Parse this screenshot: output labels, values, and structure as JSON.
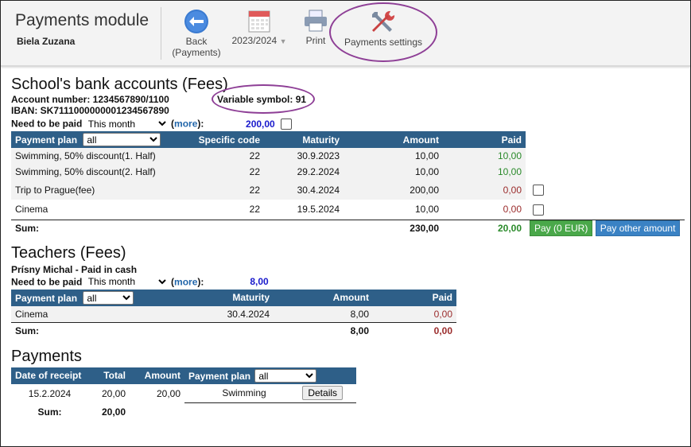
{
  "header": {
    "title": "Payments module",
    "user": "Biela Zuzana",
    "back_label_1": "Back",
    "back_label_2": "(Payments)",
    "year_label": "2023/2024",
    "print_label": "Print",
    "settings_label": "Payments settings"
  },
  "bank": {
    "title": "School's bank accounts (Fees)",
    "account": "Account number: 1234567890/1100",
    "iban": "IBAN: SK7111000000001234567890",
    "variable_symbol": "Variable symbol: 91",
    "need_label": "Need to be paid",
    "need_period": "This month",
    "more_open": "(",
    "more_link": "more",
    "more_close": "):",
    "need_amount": "200,00",
    "columns": [
      "Payment plan",
      "Specific code",
      "Maturity",
      "Amount",
      "Paid"
    ],
    "plan_filter": "all",
    "rows": [
      {
        "plan": "Swimming, 50% discount(1. Half)",
        "code": "22",
        "maturity": "30.9.2023",
        "amount": "10,00",
        "paid": "10,00"
      },
      {
        "plan": "Swimming, 50% discount(2. Half)",
        "code": "22",
        "maturity": "29.2.2024",
        "amount": "10,00",
        "paid": "10,00"
      },
      {
        "plan": "Trip to Prague(fee)",
        "code": "22",
        "maturity": "30.4.2024",
        "amount": "200,00",
        "paid": "0,00"
      },
      {
        "plan": "Cinema",
        "code": "22",
        "maturity": "19.5.2024",
        "amount": "10,00",
        "paid": "0,00"
      }
    ],
    "sum_label": "Sum:",
    "sum_amount": "230,00",
    "sum_paid": "20,00",
    "pay_button": "Pay (0 EUR)",
    "pay_other_button": "Pay other amount"
  },
  "teachers": {
    "title": "Teachers (Fees)",
    "subtitle": "Prísny Michal - Paid in cash",
    "need_label": "Need to be paid",
    "need_period": "This month",
    "more_open": "(",
    "more_link": "more",
    "more_close": "):",
    "need_amount": "8,00",
    "columns": [
      "Payment plan",
      "Maturity",
      "Amount",
      "Paid"
    ],
    "plan_filter": "all",
    "rows": [
      {
        "plan": "Cinema",
        "maturity": "30.4.2024",
        "amount": "8,00",
        "paid": "0,00"
      }
    ],
    "sum_label": "Sum:",
    "sum_amount": "8,00",
    "sum_paid": "0,00"
  },
  "payments": {
    "title": "Payments",
    "columns": [
      "Date of receipt",
      "Total",
      "Amount",
      "Payment plan"
    ],
    "plan_filter": "all",
    "rows": [
      {
        "date": "15.2.2024",
        "total": "20,00",
        "amount": "20,00",
        "plan": "Swimming",
        "action": "Details"
      }
    ],
    "sum_label": "Sum:",
    "sum_total": "20,00"
  },
  "colors": {
    "header_blue": "#2e5f88",
    "paid_green": "#2a8a2a",
    "unpaid_red": "#9b2c2c",
    "highlight_ellipse": "#8e3f96"
  }
}
